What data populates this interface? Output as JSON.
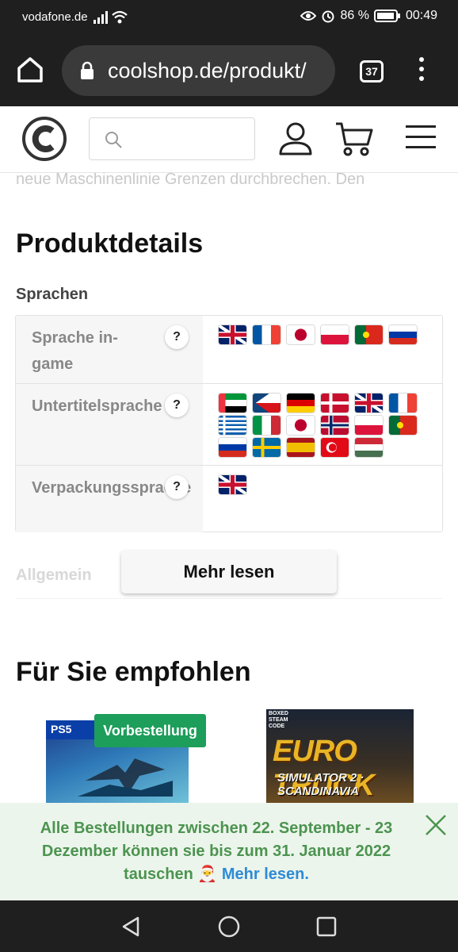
{
  "status_bar": {
    "carrier": "vodafone.de",
    "battery": "86 %",
    "time": "00:49"
  },
  "browser": {
    "url": "coolshop.de/produkt/",
    "tab_count": "37"
  },
  "site": {
    "search_placeholder": "",
    "faded_text": "neue Maschinenlinie Grenzen durchbrechen. Den"
  },
  "product_details": {
    "title": "Produktdetails",
    "languages_label": "Sprachen",
    "rows": [
      {
        "label": "Sprache in-game",
        "help": "?",
        "flags": [
          "uk",
          "fr",
          "jp",
          "pl",
          "pt",
          "ru"
        ]
      },
      {
        "label": "Untertitelsprache",
        "help": "?",
        "flags": [
          "ae",
          "cz",
          "de",
          "dk",
          "uk",
          "fr",
          "gr",
          "it",
          "jp",
          "no",
          "pl",
          "pt",
          "ru",
          "se",
          "es",
          "tr",
          "hu"
        ]
      },
      {
        "label": "Verpackungssprache",
        "help": "?",
        "flags": [
          "uk"
        ]
      }
    ],
    "general_label": "Allgemein",
    "read_more": "Mehr lesen"
  },
  "recommended": {
    "title": "Für Sie empfohlen",
    "products": [
      {
        "badge": "Vorbestellung",
        "platform": "PS5"
      },
      {
        "boxed": "BOXED STEAM CODE",
        "cover_title": "EURO TRUCK",
        "cover_subtitle": "SIMULATOR 2 · SCANDINAVIA"
      }
    ]
  },
  "banner": {
    "message": "Alle Bestellungen zwischen 22. September - 23 Dezember können sie bis zum 31. Januar 2022 tauschen",
    "emoji": "🎅",
    "link": "Mehr lesen."
  }
}
